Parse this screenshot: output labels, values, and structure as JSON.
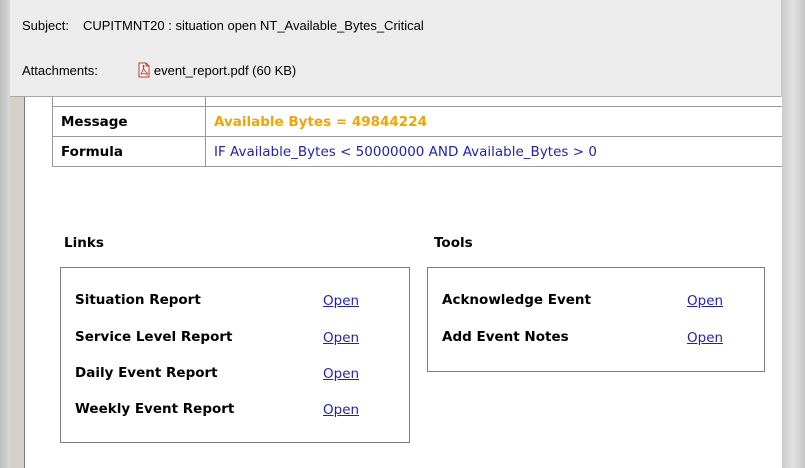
{
  "header": {
    "subject_label": "Subject:",
    "subject_value": "CUPITMNT20 : situation open NT_Available_Bytes_Critical",
    "attachments_label": "Attachments:",
    "attachment_name": "event_report.pdf (60 KB)",
    "attachment_icon": "pdf-file-icon"
  },
  "details": {
    "rows": [
      {
        "key": "Message",
        "value": "Available Bytes = 49844224"
      },
      {
        "key": "Formula",
        "value": "IF Available_Bytes < 50000000 AND Available_Bytes > 0"
      }
    ]
  },
  "links": {
    "title": "Links",
    "items": [
      {
        "label": "Situation Report",
        "action": "Open"
      },
      {
        "label": "Service Level Report",
        "action": "Open"
      },
      {
        "label": "Daily Event Report",
        "action": "Open"
      },
      {
        "label": "Weekly Event Report",
        "action": "Open"
      }
    ]
  },
  "tools": {
    "title": "Tools",
    "items": [
      {
        "label": "Acknowledge Event",
        "action": "Open"
      },
      {
        "label": "Add Event Notes",
        "action": "Open"
      }
    ]
  },
  "colors": {
    "message_value": "#f5a300",
    "link": "#1f1fc0"
  }
}
